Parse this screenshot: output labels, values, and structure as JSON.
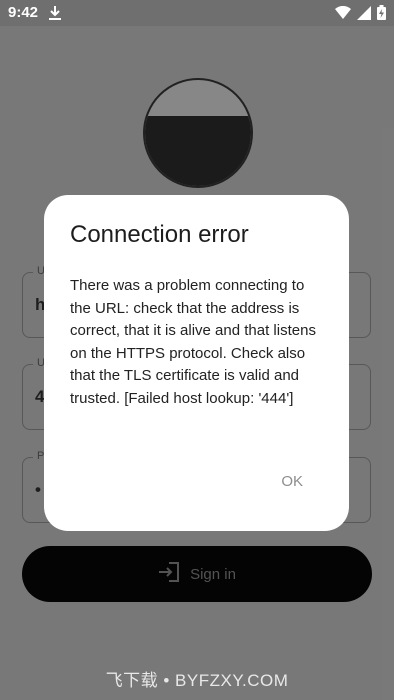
{
  "status_bar": {
    "time": "9:42",
    "icons": [
      "download-icon",
      "wifi-icon",
      "signal-icon",
      "battery-icon"
    ]
  },
  "form": {
    "url_field": {
      "label": "U",
      "value": "h"
    },
    "port_field": {
      "label": "U",
      "value": "4"
    },
    "password_field": {
      "label": "P",
      "value": "•"
    },
    "sign_in_label": "Sign in"
  },
  "dialog": {
    "title": "Connection error",
    "message": "There was a problem connecting to the URL: check that the address is correct, that it is alive and that listens on the HTTPS protocol. Check also that the TLS certificate is valid and trusted. [Failed host lookup: '444']",
    "ok_label": "OK"
  },
  "watermark": "飞下载 • BYFZXY.COM"
}
